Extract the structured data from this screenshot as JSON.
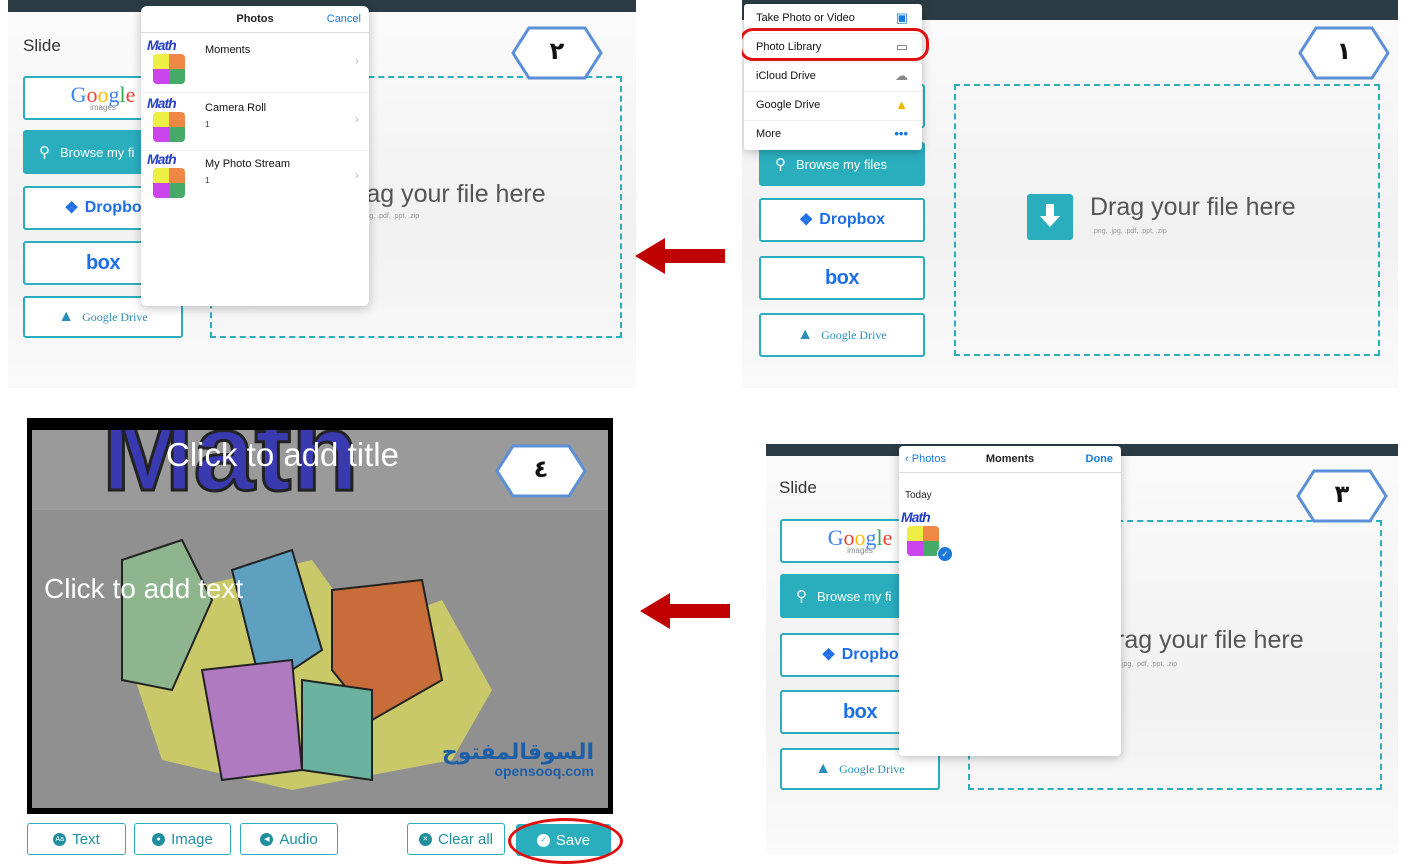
{
  "step_numbers": [
    "١",
    "٢",
    "٣",
    "٤"
  ],
  "colors": {
    "accent": "#2aaebe",
    "highlight": "#e01010",
    "arrow": "#c00000",
    "hex_stroke": "#5b8fd6"
  },
  "common": {
    "slide_label": "Slide",
    "google_logo": "Google",
    "google_sub": "images",
    "browse_label": "Browse my files",
    "browse_label_cut": "Browse my fi",
    "dropbox_label": "Dropbox",
    "dropbox_label_cut": "Dropbo",
    "box_label": "box",
    "gdrive_label": "Google Drive",
    "drag_text": "Drag your file here",
    "drag_text_cut": "rag your file here",
    "drag_sub": ".png, .jpg, .pdf, .ppt, .zip",
    "drag_sub_cut": ".jpg, .pdf, .ppt, .zip"
  },
  "panel1": {
    "share_menu": [
      {
        "label": "Take Photo or Video",
        "icon": "camera-icon"
      },
      {
        "label": "Photo Library",
        "icon": "photo-library-icon"
      },
      {
        "label": "iCloud Drive",
        "icon": "cloud-icon"
      },
      {
        "label": "Google Drive",
        "icon": "google-drive-icon"
      },
      {
        "label": "More",
        "icon": "more-icon",
        "glyph": "•••"
      }
    ]
  },
  "panel2": {
    "popover_title": "Photos",
    "popover_cancel": "Cancel",
    "albums": [
      {
        "name": "Moments",
        "count": ""
      },
      {
        "name": "Camera Roll",
        "count": "1"
      },
      {
        "name": "My Photo Stream",
        "count": "1"
      }
    ],
    "thumb_text": "Math"
  },
  "panel3": {
    "back_label": "Photos",
    "title": "Moments",
    "done_label": "Done",
    "section": "Today"
  },
  "panel4": {
    "title_placeholder": "Click to add title",
    "text_placeholder": "Click to add text",
    "watermark_ar": "السوقالمفتوح",
    "watermark_en": "opensooq.com",
    "toolbar": {
      "text": "Text",
      "image": "Image",
      "audio": "Audio",
      "clear": "Clear all",
      "save": "Save"
    }
  }
}
